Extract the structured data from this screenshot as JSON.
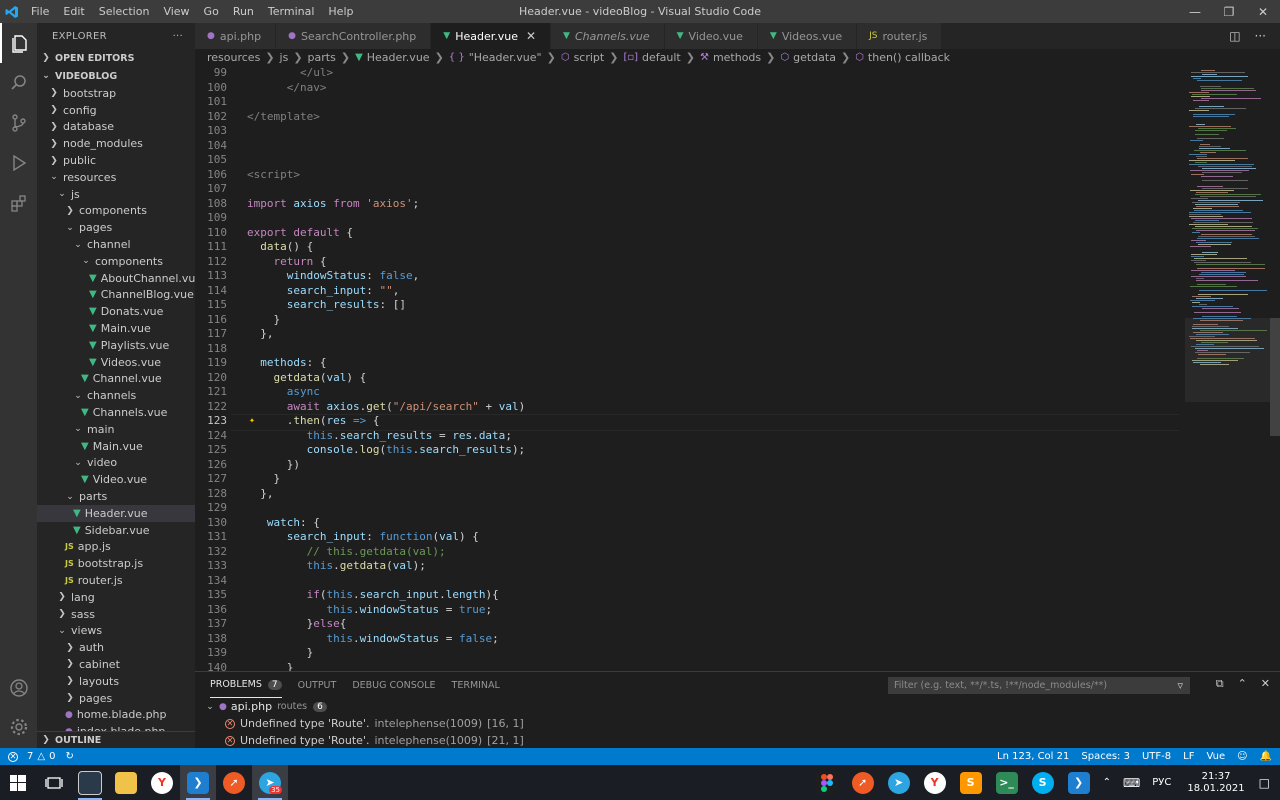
{
  "window": {
    "title": "Header.vue - videoBlog - Visual Studio Code",
    "menu": [
      "File",
      "Edit",
      "Selection",
      "View",
      "Go",
      "Run",
      "Terminal",
      "Help"
    ]
  },
  "sidebar": {
    "title": "EXPLORER",
    "open_editors": "OPEN EDITORS",
    "project": "VIDEOBLOG",
    "outline": "OUTLINE",
    "tree": [
      {
        "label": "bootstrap",
        "depth": 0,
        "type": "folder",
        "open": false
      },
      {
        "label": "config",
        "depth": 0,
        "type": "folder",
        "open": false
      },
      {
        "label": "database",
        "depth": 0,
        "type": "folder",
        "open": false
      },
      {
        "label": "node_modules",
        "depth": 0,
        "type": "folder",
        "open": false
      },
      {
        "label": "public",
        "depth": 0,
        "type": "folder",
        "open": false
      },
      {
        "label": "resources",
        "depth": 0,
        "type": "folder",
        "open": true
      },
      {
        "label": "js",
        "depth": 1,
        "type": "folder",
        "open": true
      },
      {
        "label": "components",
        "depth": 2,
        "type": "folder",
        "open": false
      },
      {
        "label": "pages",
        "depth": 2,
        "type": "folder",
        "open": true
      },
      {
        "label": "channel",
        "depth": 3,
        "type": "folder",
        "open": true
      },
      {
        "label": "components",
        "depth": 4,
        "type": "folder",
        "open": true
      },
      {
        "label": "AboutChannel.vue",
        "depth": 5,
        "type": "vue"
      },
      {
        "label": "ChannelBlog.vue",
        "depth": 5,
        "type": "vue"
      },
      {
        "label": "Donats.vue",
        "depth": 5,
        "type": "vue"
      },
      {
        "label": "Main.vue",
        "depth": 5,
        "type": "vue"
      },
      {
        "label": "Playlists.vue",
        "depth": 5,
        "type": "vue"
      },
      {
        "label": "Videos.vue",
        "depth": 5,
        "type": "vue"
      },
      {
        "label": "Channel.vue",
        "depth": 4,
        "type": "vue"
      },
      {
        "label": "channels",
        "depth": 3,
        "type": "folder",
        "open": true
      },
      {
        "label": "Channels.vue",
        "depth": 4,
        "type": "vue"
      },
      {
        "label": "main",
        "depth": 3,
        "type": "folder",
        "open": true
      },
      {
        "label": "Main.vue",
        "depth": 4,
        "type": "vue"
      },
      {
        "label": "video",
        "depth": 3,
        "type": "folder",
        "open": true
      },
      {
        "label": "Video.vue",
        "depth": 4,
        "type": "vue"
      },
      {
        "label": "parts",
        "depth": 2,
        "type": "folder",
        "open": true
      },
      {
        "label": "Header.vue",
        "depth": 3,
        "type": "vue",
        "selected": true
      },
      {
        "label": "Sidebar.vue",
        "depth": 3,
        "type": "vue"
      },
      {
        "label": "app.js",
        "depth": 2,
        "type": "js"
      },
      {
        "label": "bootstrap.js",
        "depth": 2,
        "type": "js"
      },
      {
        "label": "router.js",
        "depth": 2,
        "type": "js"
      },
      {
        "label": "lang",
        "depth": 1,
        "type": "folder",
        "open": false
      },
      {
        "label": "sass",
        "depth": 1,
        "type": "folder",
        "open": false
      },
      {
        "label": "views",
        "depth": 1,
        "type": "folder",
        "open": true
      },
      {
        "label": "auth",
        "depth": 2,
        "type": "folder",
        "open": false
      },
      {
        "label": "cabinet",
        "depth": 2,
        "type": "folder",
        "open": false
      },
      {
        "label": "layouts",
        "depth": 2,
        "type": "folder",
        "open": false
      },
      {
        "label": "pages",
        "depth": 2,
        "type": "folder",
        "open": false
      },
      {
        "label": "home.blade.php",
        "depth": 2,
        "type": "php"
      },
      {
        "label": "index.blade.php",
        "depth": 2,
        "type": "php"
      }
    ]
  },
  "tabs": [
    {
      "label": "api.php",
      "icon": "php",
      "active": false,
      "italic": false
    },
    {
      "label": "SearchController.php",
      "icon": "php",
      "active": false,
      "italic": false
    },
    {
      "label": "Header.vue",
      "icon": "vue",
      "active": true,
      "italic": false
    },
    {
      "label": "Channels.vue",
      "icon": "vue",
      "active": false,
      "italic": true
    },
    {
      "label": "Video.vue",
      "icon": "vue",
      "active": false,
      "italic": false
    },
    {
      "label": "Videos.vue",
      "icon": "vue",
      "active": false,
      "italic": false
    },
    {
      "label": "router.js",
      "icon": "js",
      "active": false,
      "italic": false
    }
  ],
  "breadcrumb": [
    "resources",
    "js",
    "parts",
    "Header.vue",
    "\"Header.vue\"",
    "script",
    "default",
    "methods",
    "getdata",
    "then() callback"
  ],
  "editor": {
    "current_line": 123,
    "lines": [
      {
        "n": 99,
        "t": [
          [
            "t-tag",
            "        </ul>"
          ]
        ]
      },
      {
        "n": 100,
        "t": [
          [
            "t-tag",
            "      </nav>"
          ]
        ]
      },
      {
        "n": 101,
        "t": []
      },
      {
        "n": 102,
        "t": [
          [
            "t-tag",
            "</template>"
          ]
        ]
      },
      {
        "n": 103,
        "t": []
      },
      {
        "n": 104,
        "t": []
      },
      {
        "n": 105,
        "t": []
      },
      {
        "n": 106,
        "t": [
          [
            "t-tag",
            "<script>"
          ]
        ]
      },
      {
        "n": 107,
        "t": []
      },
      {
        "n": 108,
        "t": [
          [
            "t-ctl",
            "import "
          ],
          [
            "t-var",
            "axios "
          ],
          [
            "t-ctl",
            "from "
          ],
          [
            "t-str",
            "'axios'"
          ],
          [
            "t-pl",
            ";"
          ]
        ]
      },
      {
        "n": 109,
        "t": []
      },
      {
        "n": 110,
        "t": [
          [
            "t-ctl",
            "export default "
          ],
          [
            "t-pl",
            "{"
          ]
        ]
      },
      {
        "n": 111,
        "t": [
          [
            "t-fn",
            "  data"
          ],
          [
            "t-pl",
            "() {"
          ]
        ]
      },
      {
        "n": 112,
        "t": [
          [
            "t-ctl",
            "    return "
          ],
          [
            "t-pl",
            "{"
          ]
        ]
      },
      {
        "n": 113,
        "t": [
          [
            "t-var",
            "      windowStatus"
          ],
          [
            "t-pl",
            ": "
          ],
          [
            "t-kw",
            "false"
          ],
          [
            "t-pl",
            ","
          ]
        ]
      },
      {
        "n": 114,
        "t": [
          [
            "t-var",
            "      search_input"
          ],
          [
            "t-pl",
            ": "
          ],
          [
            "t-str",
            "\"\""
          ],
          [
            "t-pl",
            ","
          ]
        ]
      },
      {
        "n": 115,
        "t": [
          [
            "t-var",
            "      search_results"
          ],
          [
            "t-pl",
            ": []"
          ]
        ]
      },
      {
        "n": 116,
        "t": [
          [
            "t-pl",
            "    }"
          ]
        ]
      },
      {
        "n": 117,
        "t": [
          [
            "t-pl",
            "  },"
          ]
        ]
      },
      {
        "n": 118,
        "t": []
      },
      {
        "n": 119,
        "t": [
          [
            "t-var",
            "  methods"
          ],
          [
            "t-pl",
            ": {"
          ]
        ]
      },
      {
        "n": 120,
        "t": [
          [
            "t-fn",
            "    getdata"
          ],
          [
            "t-pl",
            "("
          ],
          [
            "t-var",
            "val"
          ],
          [
            "t-pl",
            ") {"
          ]
        ]
      },
      {
        "n": 121,
        "t": [
          [
            "t-kw",
            "      async"
          ]
        ]
      },
      {
        "n": 122,
        "t": [
          [
            "t-ctl",
            "      await "
          ],
          [
            "t-var",
            "axios"
          ],
          [
            "t-pl",
            "."
          ],
          [
            "t-fn",
            "get"
          ],
          [
            "t-pl",
            "("
          ],
          [
            "t-str",
            "\"/api/search\""
          ],
          [
            "t-pl",
            " + "
          ],
          [
            "t-var",
            "val"
          ],
          [
            "t-pl",
            ")"
          ]
        ]
      },
      {
        "n": 123,
        "t": [
          [
            "t-pl",
            "      ."
          ],
          [
            "t-fn",
            "then"
          ],
          [
            "t-pl",
            "("
          ],
          [
            "t-var",
            "res"
          ],
          [
            "t-kw",
            " => "
          ],
          [
            "t-pl",
            "{"
          ]
        ]
      },
      {
        "n": 124,
        "t": [
          [
            "t-this",
            "         this"
          ],
          [
            "t-pl",
            "."
          ],
          [
            "t-var",
            "search_results"
          ],
          [
            "t-pl",
            " = "
          ],
          [
            "t-var",
            "res"
          ],
          [
            "t-pl",
            "."
          ],
          [
            "t-var",
            "data"
          ],
          [
            "t-pl",
            ";"
          ]
        ]
      },
      {
        "n": 125,
        "t": [
          [
            "t-var",
            "         console"
          ],
          [
            "t-pl",
            "."
          ],
          [
            "t-fn",
            "log"
          ],
          [
            "t-pl",
            "("
          ],
          [
            "t-this",
            "this"
          ],
          [
            "t-pl",
            "."
          ],
          [
            "t-var",
            "search_results"
          ],
          [
            "t-pl",
            ");"
          ]
        ]
      },
      {
        "n": 126,
        "t": [
          [
            "t-pl",
            "      })"
          ]
        ]
      },
      {
        "n": 127,
        "t": [
          [
            "t-pl",
            "    }"
          ]
        ]
      },
      {
        "n": 128,
        "t": [
          [
            "t-pl",
            "  },"
          ]
        ]
      },
      {
        "n": 129,
        "t": []
      },
      {
        "n": 130,
        "t": [
          [
            "t-var",
            "   watch"
          ],
          [
            "t-pl",
            ": {"
          ]
        ]
      },
      {
        "n": 131,
        "t": [
          [
            "t-var",
            "      search_input"
          ],
          [
            "t-pl",
            ": "
          ],
          [
            "t-kw",
            "function"
          ],
          [
            "t-pl",
            "("
          ],
          [
            "t-var",
            "val"
          ],
          [
            "t-pl",
            ") {"
          ]
        ]
      },
      {
        "n": 132,
        "t": [
          [
            "t-com",
            "         // this.getdata(val);"
          ]
        ]
      },
      {
        "n": 133,
        "t": [
          [
            "t-this",
            "         this"
          ],
          [
            "t-pl",
            "."
          ],
          [
            "t-fn",
            "getdata"
          ],
          [
            "t-pl",
            "("
          ],
          [
            "t-var",
            "val"
          ],
          [
            "t-pl",
            ");"
          ]
        ]
      },
      {
        "n": 134,
        "t": []
      },
      {
        "n": 135,
        "t": [
          [
            "t-ctl",
            "         if"
          ],
          [
            "t-pl",
            "("
          ],
          [
            "t-this",
            "this"
          ],
          [
            "t-pl",
            "."
          ],
          [
            "t-var",
            "search_input"
          ],
          [
            "t-pl",
            "."
          ],
          [
            "t-var",
            "length"
          ],
          [
            "t-pl",
            "){"
          ]
        ]
      },
      {
        "n": 136,
        "t": [
          [
            "t-this",
            "            this"
          ],
          [
            "t-pl",
            "."
          ],
          [
            "t-var",
            "windowStatus"
          ],
          [
            "t-pl",
            " = "
          ],
          [
            "t-kw",
            "true"
          ],
          [
            "t-pl",
            ";"
          ]
        ]
      },
      {
        "n": 137,
        "t": [
          [
            "t-pl",
            "         }"
          ],
          [
            "t-ctl",
            "else"
          ],
          [
            "t-pl",
            "{"
          ]
        ]
      },
      {
        "n": 138,
        "t": [
          [
            "t-this",
            "            this"
          ],
          [
            "t-pl",
            "."
          ],
          [
            "t-var",
            "windowStatus"
          ],
          [
            "t-pl",
            " = "
          ],
          [
            "t-kw",
            "false"
          ],
          [
            "t-pl",
            ";"
          ]
        ]
      },
      {
        "n": 139,
        "t": [
          [
            "t-pl",
            "         }"
          ]
        ]
      },
      {
        "n": 140,
        "t": [
          [
            "t-pl",
            "      }"
          ]
        ]
      }
    ]
  },
  "panel": {
    "tabs": [
      {
        "label": "PROBLEMS",
        "badge": "7",
        "active": true
      },
      {
        "label": "OUTPUT",
        "badge": "",
        "active": false
      },
      {
        "label": "DEBUG CONSOLE",
        "badge": "",
        "active": false
      },
      {
        "label": "TERMINAL",
        "badge": "",
        "active": false
      }
    ],
    "filter_placeholder": "Filter (e.g. text, **/*.ts, !**/node_modules/**)",
    "group": {
      "file": "api.php",
      "path": "routes",
      "count": "6"
    },
    "problems": [
      {
        "msg": "Undefined type 'Route'.",
        "src": "intelephense(1009)",
        "pos": "[16, 1]"
      },
      {
        "msg": "Undefined type 'Route'.",
        "src": "intelephense(1009)",
        "pos": "[21, 1]"
      }
    ]
  },
  "status": {
    "errors": "7",
    "warnings": "0",
    "position": "Ln 123, Col 21",
    "spaces": "Spaces: 3",
    "encoding": "UTF-8",
    "eol": "LF",
    "language": "Vue"
  },
  "taskbar": {
    "lang": "РУС",
    "time": "21:37",
    "date": "18.01.2021",
    "badge": "35"
  }
}
